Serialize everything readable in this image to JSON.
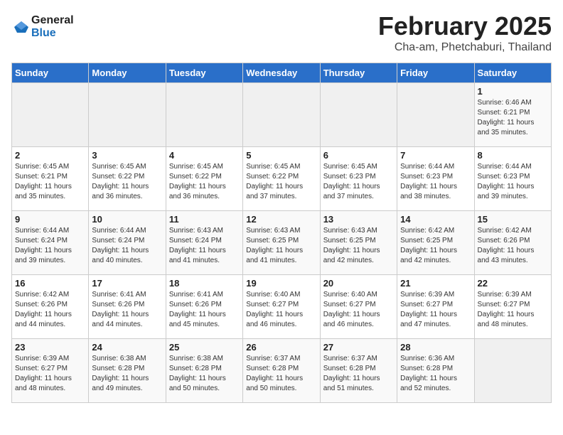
{
  "header": {
    "title": "February 2025",
    "subtitle": "Cha-am, Phetchaburi, Thailand",
    "logo_general": "General",
    "logo_blue": "Blue"
  },
  "days_of_week": [
    "Sunday",
    "Monday",
    "Tuesday",
    "Wednesday",
    "Thursday",
    "Friday",
    "Saturday"
  ],
  "weeks": [
    [
      {
        "day": "",
        "info": ""
      },
      {
        "day": "",
        "info": ""
      },
      {
        "day": "",
        "info": ""
      },
      {
        "day": "",
        "info": ""
      },
      {
        "day": "",
        "info": ""
      },
      {
        "day": "",
        "info": ""
      },
      {
        "day": "1",
        "info": "Sunrise: 6:46 AM\nSunset: 6:21 PM\nDaylight: 11 hours\nand 35 minutes."
      }
    ],
    [
      {
        "day": "2",
        "info": "Sunrise: 6:45 AM\nSunset: 6:21 PM\nDaylight: 11 hours\nand 35 minutes."
      },
      {
        "day": "3",
        "info": "Sunrise: 6:45 AM\nSunset: 6:22 PM\nDaylight: 11 hours\nand 36 minutes."
      },
      {
        "day": "4",
        "info": "Sunrise: 6:45 AM\nSunset: 6:22 PM\nDaylight: 11 hours\nand 36 minutes."
      },
      {
        "day": "5",
        "info": "Sunrise: 6:45 AM\nSunset: 6:22 PM\nDaylight: 11 hours\nand 37 minutes."
      },
      {
        "day": "6",
        "info": "Sunrise: 6:45 AM\nSunset: 6:23 PM\nDaylight: 11 hours\nand 37 minutes."
      },
      {
        "day": "7",
        "info": "Sunrise: 6:44 AM\nSunset: 6:23 PM\nDaylight: 11 hours\nand 38 minutes."
      },
      {
        "day": "8",
        "info": "Sunrise: 6:44 AM\nSunset: 6:23 PM\nDaylight: 11 hours\nand 39 minutes."
      }
    ],
    [
      {
        "day": "9",
        "info": "Sunrise: 6:44 AM\nSunset: 6:24 PM\nDaylight: 11 hours\nand 39 minutes."
      },
      {
        "day": "10",
        "info": "Sunrise: 6:44 AM\nSunset: 6:24 PM\nDaylight: 11 hours\nand 40 minutes."
      },
      {
        "day": "11",
        "info": "Sunrise: 6:43 AM\nSunset: 6:24 PM\nDaylight: 11 hours\nand 41 minutes."
      },
      {
        "day": "12",
        "info": "Sunrise: 6:43 AM\nSunset: 6:25 PM\nDaylight: 11 hours\nand 41 minutes."
      },
      {
        "day": "13",
        "info": "Sunrise: 6:43 AM\nSunset: 6:25 PM\nDaylight: 11 hours\nand 42 minutes."
      },
      {
        "day": "14",
        "info": "Sunrise: 6:42 AM\nSunset: 6:25 PM\nDaylight: 11 hours\nand 42 minutes."
      },
      {
        "day": "15",
        "info": "Sunrise: 6:42 AM\nSunset: 6:26 PM\nDaylight: 11 hours\nand 43 minutes."
      }
    ],
    [
      {
        "day": "16",
        "info": "Sunrise: 6:42 AM\nSunset: 6:26 PM\nDaylight: 11 hours\nand 44 minutes."
      },
      {
        "day": "17",
        "info": "Sunrise: 6:41 AM\nSunset: 6:26 PM\nDaylight: 11 hours\nand 44 minutes."
      },
      {
        "day": "18",
        "info": "Sunrise: 6:41 AM\nSunset: 6:26 PM\nDaylight: 11 hours\nand 45 minutes."
      },
      {
        "day": "19",
        "info": "Sunrise: 6:40 AM\nSunset: 6:27 PM\nDaylight: 11 hours\nand 46 minutes."
      },
      {
        "day": "20",
        "info": "Sunrise: 6:40 AM\nSunset: 6:27 PM\nDaylight: 11 hours\nand 46 minutes."
      },
      {
        "day": "21",
        "info": "Sunrise: 6:39 AM\nSunset: 6:27 PM\nDaylight: 11 hours\nand 47 minutes."
      },
      {
        "day": "22",
        "info": "Sunrise: 6:39 AM\nSunset: 6:27 PM\nDaylight: 11 hours\nand 48 minutes."
      }
    ],
    [
      {
        "day": "23",
        "info": "Sunrise: 6:39 AM\nSunset: 6:27 PM\nDaylight: 11 hours\nand 48 minutes."
      },
      {
        "day": "24",
        "info": "Sunrise: 6:38 AM\nSunset: 6:28 PM\nDaylight: 11 hours\nand 49 minutes."
      },
      {
        "day": "25",
        "info": "Sunrise: 6:38 AM\nSunset: 6:28 PM\nDaylight: 11 hours\nand 50 minutes."
      },
      {
        "day": "26",
        "info": "Sunrise: 6:37 AM\nSunset: 6:28 PM\nDaylight: 11 hours\nand 50 minutes."
      },
      {
        "day": "27",
        "info": "Sunrise: 6:37 AM\nSunset: 6:28 PM\nDaylight: 11 hours\nand 51 minutes."
      },
      {
        "day": "28",
        "info": "Sunrise: 6:36 AM\nSunset: 6:28 PM\nDaylight: 11 hours\nand 52 minutes."
      },
      {
        "day": "",
        "info": ""
      }
    ]
  ]
}
